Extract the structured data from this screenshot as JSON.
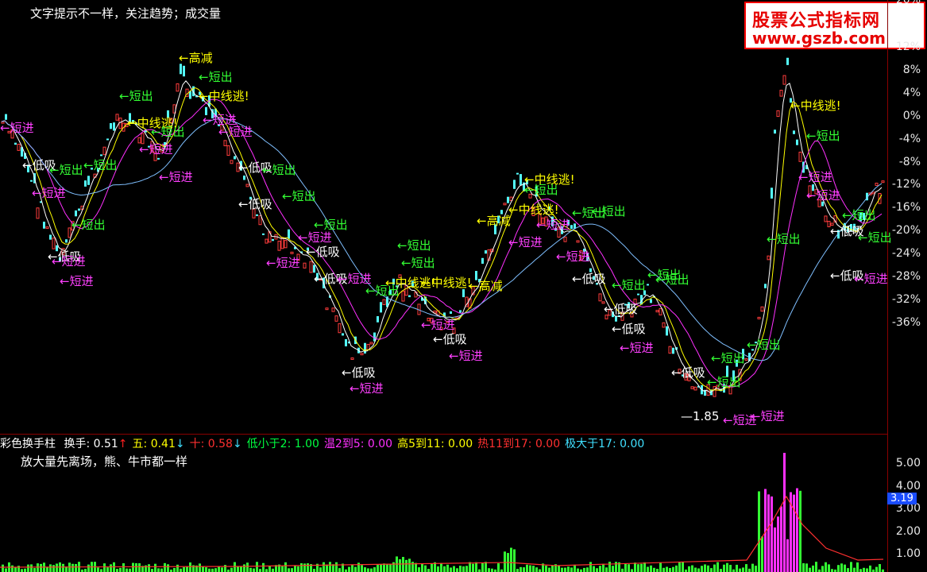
{
  "title": "文字提示不一样，关注趋势；成交量",
  "logo": {
    "line1": "股票公式指标网",
    "line2": "www.gszb.com"
  },
  "price_axis": [
    "12%",
    "8%",
    "4%",
    "0%",
    "-4%",
    "-8%",
    "-12%",
    "-16%",
    "-20%",
    "-24%",
    "-28%",
    "-32%",
    "-36%"
  ],
  "price_axis_top": "20%",
  "low_price": "1.85",
  "indicator_bar": {
    "name": "彩色换手柱",
    "items": [
      {
        "label": "换手:",
        "value": "0.51",
        "arrow": "↑",
        "color": "#ffffff",
        "arrow_color": "#ff2020"
      },
      {
        "label": "五:",
        "value": "0.41",
        "arrow": "↓",
        "color": "#ffff00",
        "arrow_color": "#40e0ff"
      },
      {
        "label": "十:",
        "value": "0.58",
        "arrow": "↓",
        "color": "#ff3030",
        "arrow_color": "#40e0ff"
      },
      {
        "label": "低小于2:",
        "value": "1.00",
        "arrow": "",
        "color": "#00ff40"
      },
      {
        "label": "温2到5:",
        "value": "0.00",
        "arrow": "",
        "color": "#ff30ff"
      },
      {
        "label": "高5到11:",
        "value": "0.00",
        "arrow": "",
        "color": "#ffff00"
      },
      {
        "label": "热11到17:",
        "value": "0.00",
        "arrow": "",
        "color": "#ff3030"
      },
      {
        "label": "极大于17:",
        "value": "0.00",
        "arrow": "",
        "color": "#40e0ff"
      }
    ]
  },
  "vol_subtitle": "放大量先离场，熊、牛市都一样",
  "vol_axis": [
    "5.00",
    "4.00",
    "3.00",
    "2.00",
    "1.00"
  ],
  "vol_current": "3.19",
  "signals": {
    "short_out": "←短出",
    "short_in": "←短进",
    "low_buy": "←低吸",
    "high_reduce": "←高减",
    "mid_escape": "←中线逃!"
  },
  "colors": {
    "up": "#ff3c3c",
    "down": "#54ffff",
    "ma5": "#ffffff",
    "ma10": "#ffff00",
    "ma20": "#ff30ff",
    "ma60": "#7fbfff",
    "short_out": "#33ff33",
    "short_in": "#ff40ff",
    "low_buy": "#ffffff",
    "high": "#ffff00"
  }
}
